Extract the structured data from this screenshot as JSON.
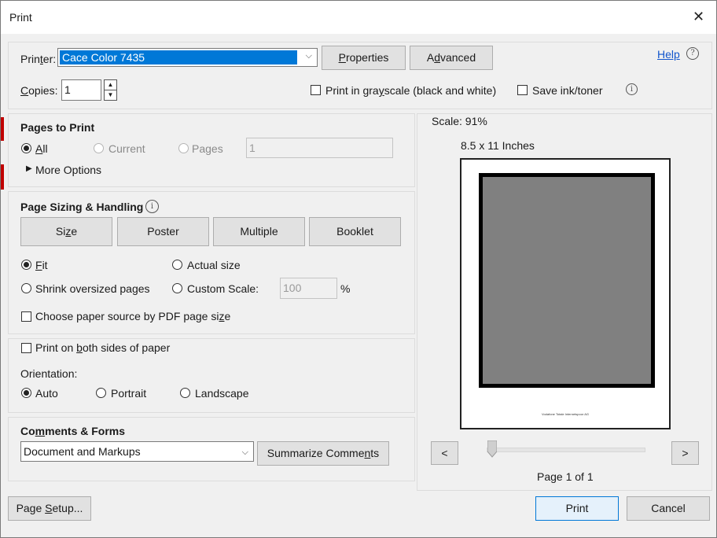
{
  "window": {
    "title": "Print"
  },
  "header": {
    "printer_label": "Printer:",
    "printer_value": "Cace Color 7435",
    "properties_label": "Properties",
    "advanced_label": "Advanced",
    "help_label": "Help",
    "copies_label": "Copies:",
    "copies_value": "1",
    "grayscale_label": "Print in grayscale (black and white)",
    "save_ink_label": "Save ink/toner"
  },
  "pages_to_print": {
    "heading": "Pages to Print",
    "all_label": "All",
    "current_label": "Current",
    "pages_label": "Pages",
    "pages_value": "1",
    "more_options_label": "More Options"
  },
  "page_sizing": {
    "heading": "Page Sizing & Handling",
    "tabs": [
      "Size",
      "Poster",
      "Multiple",
      "Booklet"
    ],
    "fit_label": "Fit",
    "actual_size_label": "Actual size",
    "shrink_label": "Shrink oversized pages",
    "custom_scale_label": "Custom Scale:",
    "custom_scale_value": "100",
    "percent_label": "%",
    "paper_source_label": "Choose paper source by PDF page size"
  },
  "duplex": {
    "both_sides_label": "Print on both sides of paper",
    "orientation_label": "Orientation:",
    "auto_label": "Auto",
    "portrait_label": "Portrait",
    "landscape_label": "Landscape"
  },
  "comments": {
    "heading": "Comments & Forms",
    "select_value": "Document and Markups",
    "summarize_label": "Summarize Comments"
  },
  "preview": {
    "scale_label": "Scale:  91%",
    "paper_size_label": "8.5 x 11 Inches",
    "prev_label": "<",
    "next_label": ">",
    "page_indicator": "Page 1 of 1",
    "page_footer_text": "Vodafone Totale Internetspoor AG"
  },
  "footer": {
    "page_setup_label": "Page Setup...",
    "print_label": "Print",
    "cancel_label": "Cancel"
  }
}
